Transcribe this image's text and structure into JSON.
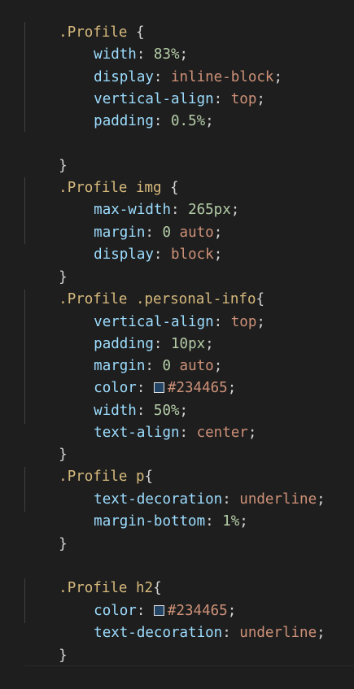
{
  "code": {
    "l1": {
      "selector": ".Profile",
      "brace": " {"
    },
    "l2": {
      "prop": "width",
      "num": "83%"
    },
    "l3": {
      "prop": "display",
      "val": "inline-block"
    },
    "l4": {
      "prop": "vertical-align",
      "val": "top"
    },
    "l5": {
      "prop": "padding",
      "num": "0.5%"
    },
    "l7": {
      "brace": "}"
    },
    "l8": {
      "selector": ".Profile img",
      "brace": " {"
    },
    "l9": {
      "prop": "max-width",
      "num": "265px"
    },
    "l10": {
      "prop": "margin",
      "num": "0",
      "val": "auto"
    },
    "l11": {
      "prop": "display",
      "val": "block"
    },
    "l12": {
      "brace": "}"
    },
    "l13": {
      "selector": ".Profile .personal-info",
      "brace": "{"
    },
    "l14": {
      "prop": "vertical-align",
      "val": "top"
    },
    "l15": {
      "prop": "padding",
      "num": "10px"
    },
    "l16": {
      "prop": "margin",
      "num": "0",
      "val": "auto"
    },
    "l17": {
      "prop": "color",
      "val": "#234465",
      "swatch": "#234465"
    },
    "l18": {
      "prop": "width",
      "num": "50%"
    },
    "l19": {
      "prop": "text-align",
      "val": "center"
    },
    "l20": {
      "brace": "}"
    },
    "l21": {
      "selector": ".Profile p",
      "brace": "{"
    },
    "l22": {
      "prop": "text-decoration",
      "val": "underline"
    },
    "l23": {
      "prop": "margin-bottom",
      "num": "1%"
    },
    "l24": {
      "brace": "}"
    },
    "l26": {
      "selector": ".Profile h2",
      "brace": "{"
    },
    "l27": {
      "prop": "color",
      "val": "#234465",
      "swatch": "#234465"
    },
    "l28": {
      "prop": "text-decoration",
      "val": "underline"
    },
    "l29": {
      "brace": "}"
    }
  },
  "punct": {
    "colon": ": ",
    "semi": ";",
    "space": " "
  },
  "colors": {
    "background": "#1e1e1e",
    "selector": "#d7ba7d",
    "property": "#9cdcfe",
    "value_string": "#ce9178",
    "value_number": "#b5cea8",
    "punctuation": "#d4d4d4"
  }
}
